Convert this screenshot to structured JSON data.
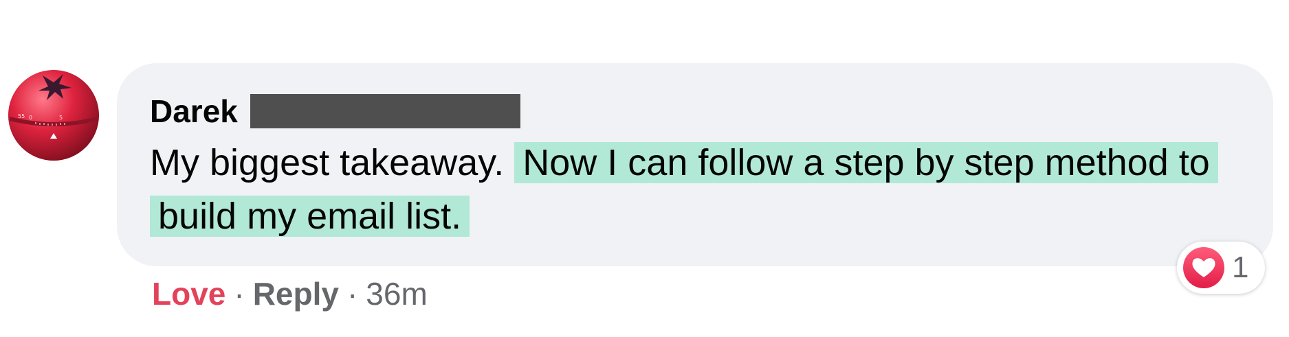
{
  "comment": {
    "author": "Darek",
    "text_plain": "My biggest takeaway. ",
    "text_highlighted": "Now I can follow a step by step method to build my email list."
  },
  "actions": {
    "love": "Love",
    "reply": "Reply",
    "separator": "·",
    "timestamp": "36m"
  },
  "reactions": {
    "icon": "heart-icon",
    "count": "1"
  },
  "colors": {
    "bubble": "#f0f2f5",
    "highlight": "#b2e8d6",
    "love": "#e4425a",
    "redaction": "#4f4f4f"
  },
  "avatar": {
    "icon": "tomato-timer-icon"
  }
}
